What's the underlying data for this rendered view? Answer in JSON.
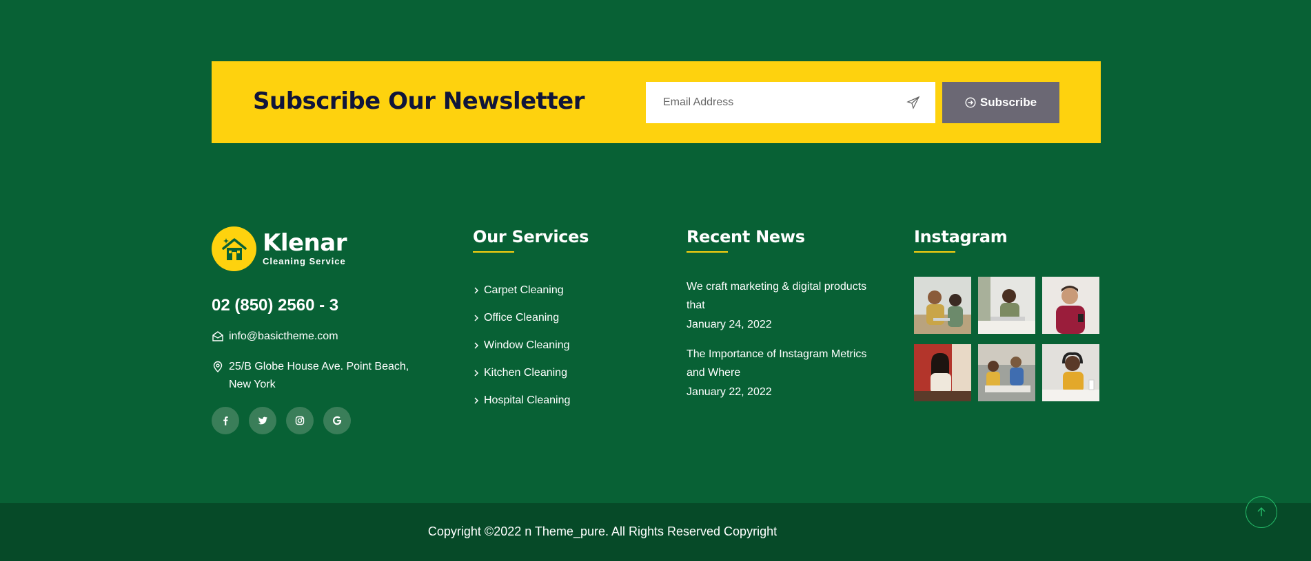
{
  "newsletter": {
    "title": "Subscribe Our Newsletter",
    "email_placeholder": "Email Address",
    "subscribe_label": "Subscribe"
  },
  "brand": {
    "name": "Klenar",
    "tagline": "Cleaning Service"
  },
  "contact": {
    "phone": "02 (850) 2560 - 3",
    "email": "info@basictheme.com",
    "address_line1": "25/B Globe House Ave. Point Beach,",
    "address_line2": "New York"
  },
  "social": {
    "icons": [
      "facebook-icon",
      "twitter-icon",
      "instagram-icon",
      "google-icon"
    ]
  },
  "services": {
    "title": "Our Services",
    "items": [
      "Carpet Cleaning",
      "Office Cleaning",
      "Window Cleaning",
      "Kitchen Cleaning",
      "Hospital Cleaning"
    ]
  },
  "news": {
    "title": "Recent News",
    "items": [
      {
        "title_line1": "We craft marketing & digital products",
        "title_line2": "that",
        "date": "January 24, 2022"
      },
      {
        "title_line1": "The Importance of Instagram Metrics",
        "title_line2": "and Where",
        "date": "January 22, 2022"
      }
    ]
  },
  "instagram": {
    "title": "Instagram"
  },
  "footer": {
    "copyright": "Copyright ©2022 n Theme_pure. All Rights Reserved Copyright"
  },
  "colors": {
    "background": "#086135",
    "bottom_bar": "#064a28",
    "accent_yellow": "#fed20e",
    "button_gray": "#6b6874",
    "heading_dark": "#10153a"
  }
}
